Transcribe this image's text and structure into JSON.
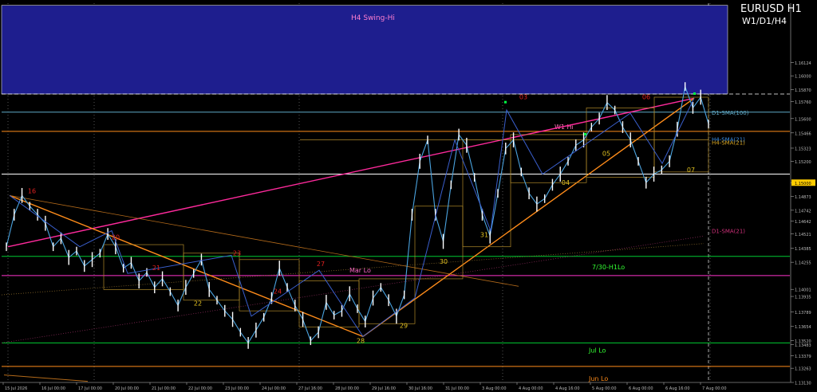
{
  "window": {
    "symbol_title": "EURUSD H1",
    "timeframes": "W1/D1/H4"
  },
  "colors": {
    "background": "#000000",
    "candle": "#ffffff",
    "price_line": "#4aa3df",
    "zigzag": "#3a5fcd",
    "trendline_orange": "#ff8c1a",
    "trendline_pink": "#ff2a9c",
    "green_level": "#00cc33",
    "magenta_level": "#ff33cc",
    "zone_fill": "#1e1e8e",
    "box": "#b08a2a"
  },
  "zone": {
    "label": "H4 Swing-Hi",
    "from": 1.164,
    "to": 1.1583
  },
  "levels": [
    {
      "name": "H4 Swing-Hi top",
      "label": "",
      "price": 1.166,
      "color": "#ffffff"
    },
    {
      "name": "D1-SMA(100)",
      "label": "D1-SMA(100)",
      "price": 1.1566,
      "color": "#5fa9c6"
    },
    {
      "name": "W1 Hi",
      "label": "W1 Hi",
      "price": 1.1548,
      "color": "#ff8c1a"
    },
    {
      "name": "white level",
      "label": "",
      "price": 1.1508,
      "color": "#ffffff"
    },
    {
      "name": "7/30-H1Lo",
      "label": "7/30-H1Lo",
      "price": 1.1431,
      "color": "#00cc33"
    },
    {
      "name": "Mar Lo",
      "label": "Mar Lo",
      "price": 1.1413,
      "color": "#ff33cc"
    },
    {
      "name": "Jul Lo",
      "label": "Jul Lo",
      "price": 1.135,
      "color": "#00cc33"
    },
    {
      "name": "Jun Lo",
      "label": "Jun Lo",
      "price": 1.1328,
      "color": "#ff8c1a"
    }
  ],
  "indicator_labels": [
    {
      "text": "D1-SMA(100)",
      "price": 1.1566,
      "color": "#5fa9c6"
    },
    {
      "text": "H4-SMA(21)",
      "price": 1.1541,
      "color": "#3a8ee6"
    },
    {
      "text": "H4-SMA(21)",
      "price": 1.1538,
      "color": "#d9a520"
    },
    {
      "text": "D1-SMA(21)",
      "price": 1.1455,
      "color": "#d0307a"
    }
  ],
  "day_labels": [
    {
      "text": "16",
      "color": "#e02020"
    },
    {
      "text": "20",
      "color": "#e02020"
    },
    {
      "text": "21",
      "color": "#e02020"
    },
    {
      "text": "22",
      "color": "#e0c020"
    },
    {
      "text": "23",
      "color": "#e02020"
    },
    {
      "text": "24",
      "color": "#e02020"
    },
    {
      "text": "27",
      "color": "#e02020"
    },
    {
      "text": "28",
      "color": "#e0c020"
    },
    {
      "text": "29",
      "color": "#e0c020"
    },
    {
      "text": "30",
      "color": "#e0c020"
    },
    {
      "text": "31",
      "color": "#e0c020"
    },
    {
      "text": "03",
      "color": "#e02020"
    },
    {
      "text": "04",
      "color": "#e0c020"
    },
    {
      "text": "05",
      "color": "#e0c020"
    },
    {
      "text": "06",
      "color": "#e02020"
    },
    {
      "text": "07",
      "color": "#e0c020"
    }
  ],
  "chart_data": {
    "type": "line",
    "title": "EURUSD H1",
    "xlabel": "",
    "ylabel": "",
    "ylim": [
      1.1313,
      1.1668
    ],
    "y_ticks": [
      1.16124,
      1.16,
      1.1587,
      1.1576,
      1.156,
      1.15466,
      1.15323,
      1.152,
      1.15,
      1.14873,
      1.14742,
      1.14642,
      1.14521,
      1.14385,
      1.14255,
      1.14001,
      1.13935,
      1.13789,
      1.13654,
      1.1352,
      1.13483,
      1.13379,
      1.13263,
      1.1313
    ],
    "x_ticks": [
      "15 Jul 2026",
      "16 Jul 00:00",
      "17 Jul 00:00",
      "20 Jul 00:00",
      "21 Jul 00:00",
      "22 Jul 00:00",
      "23 Jul 00:00",
      "24 Jul 00:00",
      "27 Jul 16:00",
      "28 Jul 00:00",
      "29 Jul 16:00",
      "30 Jul 16:00",
      "31 Jul 00:00",
      "3 Aug 00:00",
      "4 Aug 00:00",
      "4 Aug 16:00",
      "5 Aug 00:00",
      "6 Aug 00:00",
      "6 Aug 16:00",
      "7 Aug 00:00"
    ],
    "price_marker": 1.15,
    "series": [
      {
        "name": "EURUSD H1",
        "values": [
          1.144,
          1.147,
          1.1488,
          1.1478,
          1.147,
          1.1462,
          1.144,
          1.1448,
          1.143,
          1.1436,
          1.1422,
          1.1428,
          1.1434,
          1.1452,
          1.144,
          1.142,
          1.1425,
          1.1408,
          1.1416,
          1.1402,
          1.141,
          1.1398,
          1.1385,
          1.1402,
          1.1415,
          1.1428,
          1.14,
          1.139,
          1.138,
          1.1372,
          1.136,
          1.135,
          1.1362,
          1.1374,
          1.1392,
          1.142,
          1.1402,
          1.1385,
          1.1372,
          1.1352,
          1.136,
          1.1388,
          1.1376,
          1.138,
          1.1396,
          1.1382,
          1.137,
          1.1392,
          1.1402,
          1.139,
          1.1375,
          1.1395,
          1.147,
          1.152,
          1.154,
          1.147,
          1.1445,
          1.1498,
          1.1545,
          1.1535,
          1.1505,
          1.147,
          1.145,
          1.149,
          1.1532,
          1.154,
          1.151,
          1.149,
          1.148,
          1.1485,
          1.1498,
          1.1508,
          1.152,
          1.1535,
          1.154,
          1.1552,
          1.156,
          1.1575,
          1.1568,
          1.1552,
          1.154,
          1.152,
          1.15,
          1.1508,
          1.1512,
          1.152,
          1.155,
          1.159,
          1.157,
          1.158,
          1.1555
        ]
      }
    ]
  }
}
